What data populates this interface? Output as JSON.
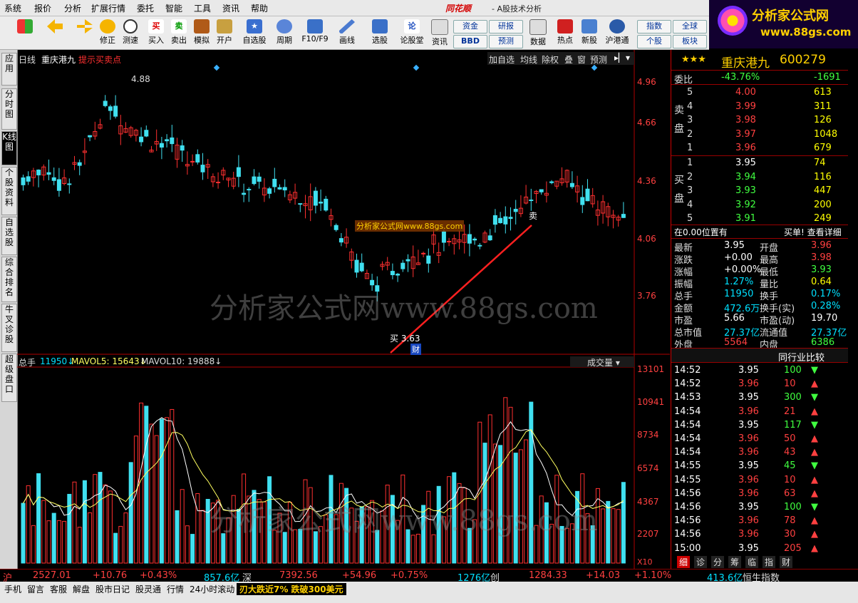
{
  "menu": {
    "items": [
      "系统",
      "报价",
      "分析",
      "扩展行情",
      "委托",
      "智能",
      "工具",
      "资讯",
      "帮助"
    ],
    "brand": "同花顺",
    "subtitle": "- A股技术分析"
  },
  "logo": {
    "line1": "分析家公式网",
    "line2": "www.88gs.com"
  },
  "toolbar": {
    "buttons": [
      "修正",
      "测速",
      "买入",
      "卖出",
      "模拟",
      "开户",
      "自选股",
      "周期",
      "F10/F9",
      "画线",
      "选股",
      "论股堂",
      "资讯",
      "数据",
      "热点",
      "新股",
      "沪港通"
    ],
    "boxes": [
      "资金",
      "研报",
      "BBD",
      "预测",
      "指数",
      "全球",
      "个股",
      "板块"
    ]
  },
  "left_tabs": [
    "应用",
    "分时图",
    "K线图",
    "个股资料",
    "自选股",
    "综合排名",
    "牛叉诊股",
    "超级盘口"
  ],
  "chart": {
    "header": {
      "period": "日线",
      "name": "重庆港九",
      "hint": "提示买卖点",
      "buttons": [
        "加自选",
        "均线",
        "除权",
        "叠",
        "窗",
        "预测"
      ]
    },
    "price_axis": [
      "4.96",
      "4.66",
      "4.36",
      "4.06",
      "3.76"
    ],
    "high_label": "4.88",
    "buy_label": "买 3.63",
    "sell_label": "卖",
    "fin_label": "财",
    "vol_header": {
      "name": "总手",
      "total": "11950↓",
      "mavol5": "MAVOL5: 15643↓",
      "mavol10": "MAVOL10: 19888↓",
      "button": "成交量"
    },
    "vol_axis": [
      "13101",
      "10941",
      "8734",
      "6574",
      "4367",
      "2207"
    ],
    "vol_unit": "X10",
    "watermark": "分析家公式网www.88gs.com",
    "stamp": "分析家公式网www.88gs.com",
    "colors": {
      "up": "#ff3030",
      "down": "#40e0f0",
      "ma5": "#ffffff",
      "ma10": "#ffff60",
      "axis": "#b00000",
      "trend": "#ff2020"
    }
  },
  "quote": {
    "stars": "★★★",
    "name": "重庆港九",
    "code": "600279",
    "weibi": {
      "label": "委比",
      "pct": "-43.76%",
      "diff": "-1691"
    },
    "sell_label": "卖盘",
    "buy_label": "买盘",
    "sells": [
      {
        "n": "5",
        "p": "4.00",
        "v": "613"
      },
      {
        "n": "4",
        "p": "3.99",
        "v": "311"
      },
      {
        "n": "3",
        "p": "3.98",
        "v": "126"
      },
      {
        "n": "2",
        "p": "3.97",
        "v": "1048"
      },
      {
        "n": "1",
        "p": "3.96",
        "v": "679"
      }
    ],
    "buys": [
      {
        "n": "1",
        "p": "3.95",
        "v": "74"
      },
      {
        "n": "2",
        "p": "3.94",
        "v": "116"
      },
      {
        "n": "3",
        "p": "3.93",
        "v": "447"
      },
      {
        "n": "4",
        "p": "3.92",
        "v": "200"
      },
      {
        "n": "5",
        "p": "3.91",
        "v": "249"
      }
    ],
    "info_left": "在0.00位置有",
    "info_right": "买单! 查看详细",
    "stats": [
      {
        "l": "最新",
        "v": "3.95",
        "l2": "开盘",
        "v2": "3.96",
        "c": "white",
        "c2": "red"
      },
      {
        "l": "涨跌",
        "v": "+0.00",
        "l2": "最高",
        "v2": "3.98",
        "c": "white",
        "c2": "red"
      },
      {
        "l": "涨幅",
        "v": "+0.00%",
        "l2": "最低",
        "v2": "3.93",
        "c": "white",
        "c2": "green"
      },
      {
        "l": "振幅",
        "v": "1.27%",
        "l2": "量比",
        "v2": "0.64",
        "c": "cyan",
        "c2": "yellow"
      },
      {
        "l": "总手",
        "v": "11950",
        "l2": "换手",
        "v2": "0.17%",
        "c": "cyan",
        "c2": "cyan"
      },
      {
        "l": "金额",
        "v": "472.6万",
        "l2": "换手(实)",
        "v2": "0.28%",
        "c": "cyan",
        "c2": "cyan"
      },
      {
        "l": "市盈",
        "v": "5.66",
        "l2": "市盈(动)",
        "v2": "19.70",
        "c": "white",
        "c2": "white"
      },
      {
        "l": "总市值",
        "v": "27.37亿",
        "l2": "流通值",
        "v2": "27.37亿",
        "c": "cyan",
        "c2": "cyan"
      },
      {
        "l": "外盘",
        "v": "5564",
        "l2": "内盘",
        "v2": "6386",
        "c": "red",
        "c2": "green"
      }
    ],
    "compare_label": "同行业比较",
    "ticks": [
      {
        "t": "14:52",
        "p": "3.95",
        "v": "100",
        "d": "down",
        "pc": "white"
      },
      {
        "t": "14:52",
        "p": "3.96",
        "v": "10",
        "d": "up",
        "pc": "red"
      },
      {
        "t": "14:53",
        "p": "3.95",
        "v": "300",
        "d": "down",
        "pc": "white"
      },
      {
        "t": "14:54",
        "p": "3.96",
        "v": "21",
        "d": "up",
        "pc": "red"
      },
      {
        "t": "14:54",
        "p": "3.95",
        "v": "117",
        "d": "down",
        "pc": "white"
      },
      {
        "t": "14:54",
        "p": "3.96",
        "v": "50",
        "d": "up",
        "pc": "red"
      },
      {
        "t": "14:54",
        "p": "3.96",
        "v": "43",
        "d": "up",
        "pc": "red"
      },
      {
        "t": "14:55",
        "p": "3.95",
        "v": "45",
        "d": "down",
        "pc": "white"
      },
      {
        "t": "14:55",
        "p": "3.96",
        "v": "10",
        "d": "up",
        "pc": "red"
      },
      {
        "t": "14:56",
        "p": "3.96",
        "v": "63",
        "d": "up",
        "pc": "red"
      },
      {
        "t": "14:56",
        "p": "3.95",
        "v": "100",
        "d": "down",
        "pc": "white"
      },
      {
        "t": "14:56",
        "p": "3.96",
        "v": "78",
        "d": "up",
        "pc": "red"
      },
      {
        "t": "14:56",
        "p": "3.96",
        "v": "30",
        "d": "up",
        "pc": "red"
      },
      {
        "t": "15:00",
        "p": "3.95",
        "v": "205",
        "d": "up",
        "pc": "white"
      }
    ],
    "tabs": [
      "细",
      "诊",
      "分",
      "筹",
      "临",
      "指",
      "财"
    ]
  },
  "index_bar": {
    "sh": {
      "label": "沪",
      "val": "2527.01",
      "chg": "+10.76",
      "pct": "+0.43%",
      "amt": "857.6亿"
    },
    "sz": {
      "label": "深",
      "val": "7392.56",
      "chg": "+54.96",
      "pct": "+0.75%",
      "amt": "1276亿"
    },
    "cy": {
      "label": "创",
      "val": "1284.33",
      "chg": "+14.03",
      "pct": "+1.10%"
    },
    "hs": {
      "amt": "413.6亿",
      "label": "恒生指数"
    }
  },
  "status_bar": {
    "items": [
      "手机",
      "留言",
      "客服",
      "解盘",
      "股市日记",
      "股灵通",
      "行情",
      "24小时滚动"
    ],
    "news": "刃大跌近7% 跌破300美元"
  }
}
